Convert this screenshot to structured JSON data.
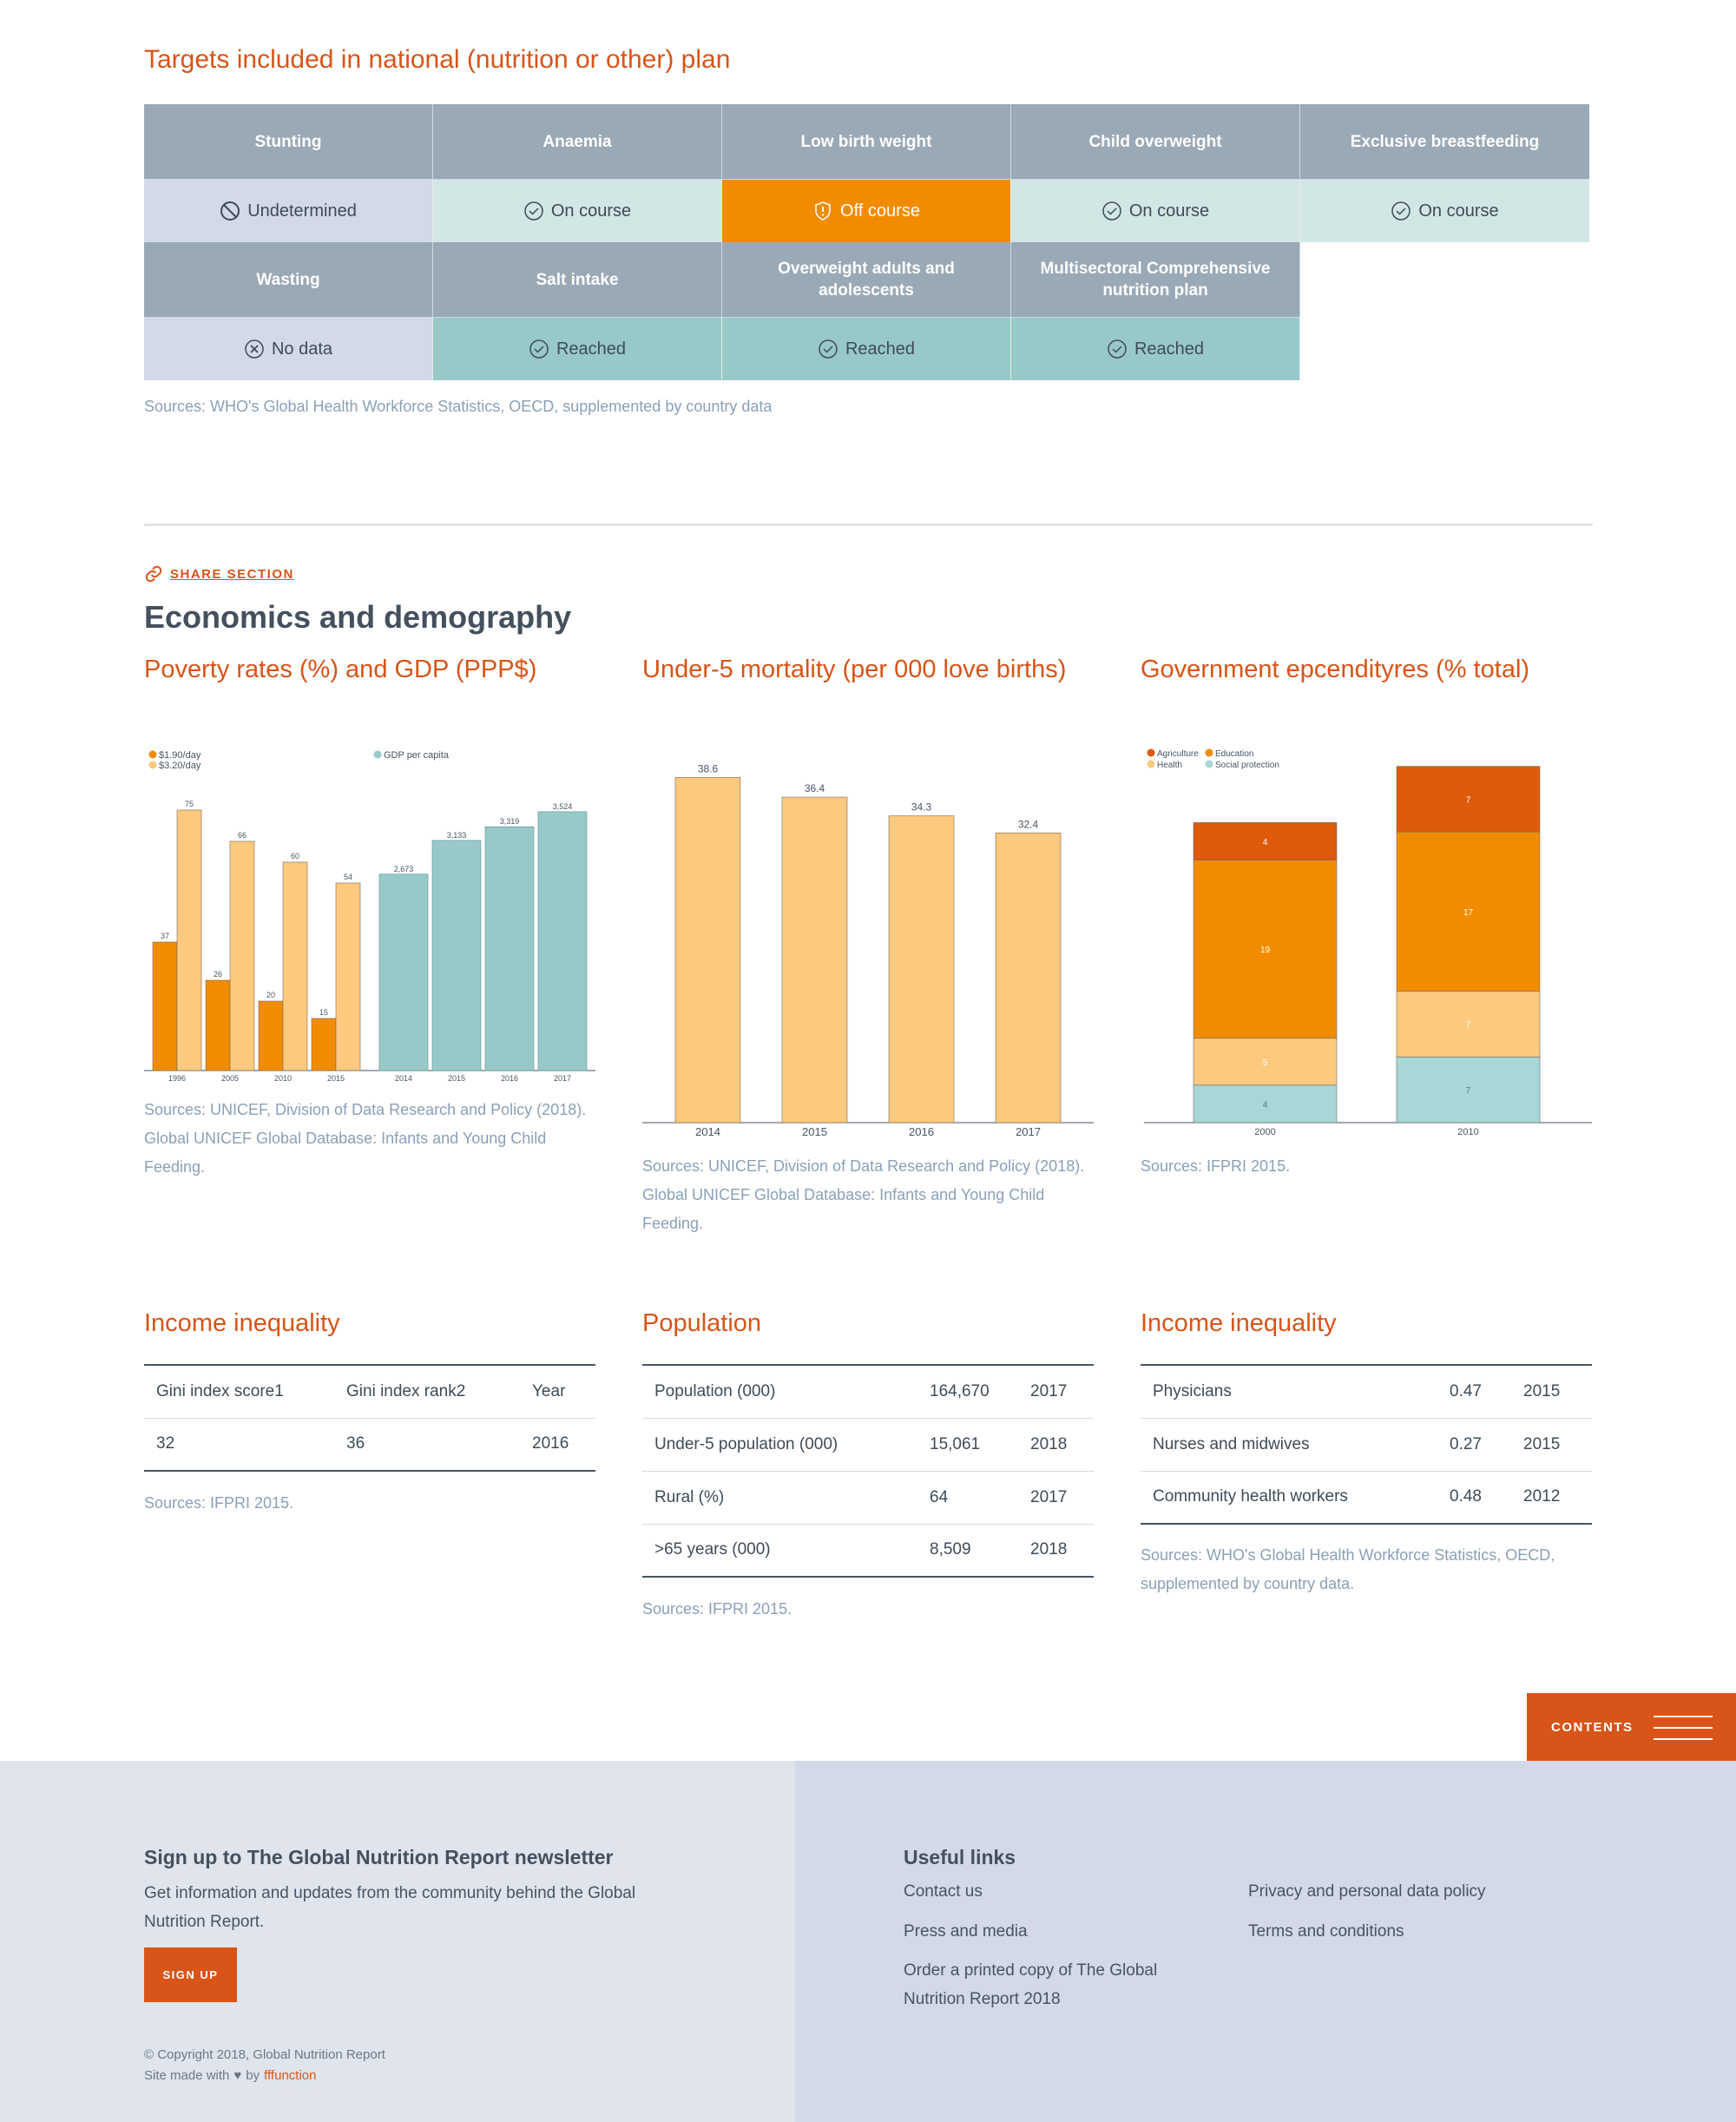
{
  "targets": {
    "title": "Targets included in national (nutrition or other) plan",
    "row1": [
      {
        "name": "Stunting",
        "status": "Undetermined",
        "kind": "undet"
      },
      {
        "name": "Anaemia",
        "status": "On course",
        "kind": "on"
      },
      {
        "name": "Low birth weight",
        "status": "Off course",
        "kind": "off"
      },
      {
        "name": "Child overweight",
        "status": "On course",
        "kind": "on"
      },
      {
        "name": "Exclusive breastfeeding",
        "status": "On course",
        "kind": "on"
      }
    ],
    "row2": [
      {
        "name": "Wasting",
        "status": "No data",
        "kind": "nodata"
      },
      {
        "name": "Salt intake",
        "status": "Reached",
        "kind": "reach"
      },
      {
        "name": "Overweight adults and adolescents",
        "status": "Reached",
        "kind": "reach"
      },
      {
        "name": "Multisectoral Comprehensive nutrition plan",
        "status": "Reached",
        "kind": "reach"
      }
    ],
    "source": "Sources: WHO's Global Health Workforce Statistics, OECD, supplemented by country data"
  },
  "section": {
    "share_label": "SHARE SECTION",
    "title": "Economics and demography"
  },
  "charts": {
    "poverty": {
      "title": "Poverty rates (%) and GDP (PPP$)",
      "source": "Sources: UNICEF, Division of Data Research and Policy (2018). Global UNICEF Global Database: Infants and Young Child Feeding.",
      "legend_a": "$1.90/day",
      "legend_b": "$3.20/day",
      "legend_c": "GDP per capita"
    },
    "mortality": {
      "title": "Under-5 mortality (per 000 love births)",
      "source": "Sources: UNICEF, Division of Data Research and Policy (2018). Global UNICEF Global Database: Infants and Young Child Feeding."
    },
    "gov": {
      "title": "Government epcendityres (% total)",
      "source": "Sources: IFPRI 2015.",
      "legend": [
        "Agriculture",
        "Education",
        "Health",
        "Social protection"
      ]
    }
  },
  "chart_data": [
    {
      "type": "bar",
      "categories": [
        "1996",
        "2005",
        "2010",
        "2015"
      ],
      "series": [
        {
          "name": "$1.90/day",
          "values": [
            37,
            26,
            20,
            15
          ]
        },
        {
          "name": "$3.20/day",
          "values": [
            75,
            66,
            60,
            54
          ]
        }
      ],
      "colors": [
        "#f18c00",
        "#fcc97e"
      ]
    },
    {
      "type": "bar",
      "categories": [
        "2014",
        "2015",
        "2016",
        "2017"
      ],
      "series": [
        {
          "name": "GDP per capita",
          "values": [
            2673,
            3133,
            3319,
            3524
          ]
        }
      ],
      "value_labels": [
        "2,673",
        "3,133",
        "3,319",
        "3,524"
      ],
      "colors": [
        "#97c9c8"
      ]
    },
    {
      "type": "bar",
      "categories": [
        "2014",
        "2015",
        "2016",
        "2017"
      ],
      "values": [
        38.6,
        36.4,
        34.3,
        32.4
      ],
      "ylim": [
        0,
        40
      ],
      "colors": [
        "#fcc97e"
      ]
    },
    {
      "type": "bar",
      "stacked": true,
      "categories": [
        "2000",
        "2010"
      ],
      "series": [
        {
          "name": "Social protection",
          "values": [
            4,
            7
          ]
        },
        {
          "name": "Health",
          "values": [
            5,
            7
          ]
        },
        {
          "name": "Education",
          "values": [
            19,
            17
          ]
        },
        {
          "name": "Agriculture",
          "values": [
            4,
            7
          ]
        }
      ],
      "colors": [
        "#a9d6d6",
        "#fcc97e",
        "#f18c00",
        "#df5a0a"
      ]
    }
  ],
  "tables": {
    "income": {
      "title": "Income inequality",
      "rows": [
        [
          "Gini index score1",
          "Gini index rank2",
          "Year"
        ],
        [
          "32",
          "36",
          "2016"
        ]
      ],
      "source": "Sources: IFPRI 2015."
    },
    "population": {
      "title": "Population",
      "rows": [
        [
          "Population (000)",
          "164,670",
          "2017"
        ],
        [
          "Under-5 population (000)",
          "15,061",
          "2018"
        ],
        [
          "Rural (%)",
          "64",
          "2017"
        ],
        [
          ">65 years (000)",
          "8,509",
          "2018"
        ]
      ],
      "source": "Sources: IFPRI 2015."
    },
    "workforce": {
      "title": "Income inequality",
      "rows": [
        [
          "Physicians",
          "0.47",
          "2015"
        ],
        [
          "Nurses and midwives",
          "0.27",
          "2015"
        ],
        [
          "Community health workers",
          "0.48",
          "2012"
        ]
      ],
      "source": "Sources: WHO's Global Health Workforce Statistics, OECD, supplemented by country data."
    }
  },
  "contents_label": "CONTENTS",
  "footer": {
    "newsletter_title": "Sign up to The Global Nutrition Report newsletter",
    "newsletter_text": "Get information and updates from the community behind the Global Nutrition Report.",
    "signup": "SIGN UP",
    "copyright": "© Copyright 2018, Global Nutrition Report",
    "made_with": "Site made with",
    "by": "by",
    "made_by": "fffunction",
    "links_title": "Useful links",
    "links_left": [
      "Contact us",
      "Press and media",
      "Order a printed copy of The Global Nutrition Report 2018"
    ],
    "links_right": [
      "Privacy and personal data policy",
      "Terms and conditions"
    ]
  }
}
